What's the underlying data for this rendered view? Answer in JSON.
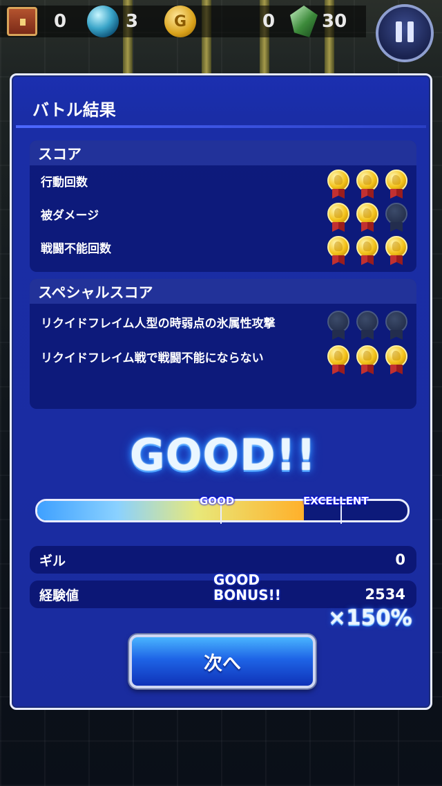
{
  "hud": {
    "treasure_count": "0",
    "orb_count": "3",
    "gil_coin_label": "G",
    "gil_count": "0",
    "crystal_count": "30",
    "icons": [
      "treasure-chest-icon",
      "orb-icon",
      "gil-coin-icon",
      "crystal-icon",
      "pause-icon"
    ]
  },
  "panel": {
    "title": "バトル結果"
  },
  "score": {
    "title": "スコア",
    "rows": [
      {
        "label": "行動回数",
        "medals": 3
      },
      {
        "label": "被ダメージ",
        "medals": 2
      },
      {
        "label": "戦闘不能回数",
        "medals": 3
      }
    ]
  },
  "special_score": {
    "title": "スペシャルスコア",
    "rows": [
      {
        "label": "リクイドフレイム人型の時弱点の氷属性攻撃",
        "medals": 0
      },
      {
        "label": "リクイドフレイム戦で戦闘不能にならない",
        "medals": 3
      }
    ]
  },
  "result": {
    "grade": "GOOD!!",
    "gauge_good_label": "GOOD",
    "gauge_excellent_label": "EXCELLENT",
    "gauge_fill_fraction": 0.72
  },
  "rewards": {
    "gil_label": "ギル",
    "gil_value": "0",
    "exp_label": "経験値",
    "exp_value": "2534",
    "bonus_line1": "GOOD",
    "bonus_line2": "BONUS!!",
    "multiplier": "×150%"
  },
  "next_button_label": "次へ",
  "colors": {
    "panel": "#1a2da6",
    "border": "#e8ecff",
    "gold": "#f3c21b"
  }
}
